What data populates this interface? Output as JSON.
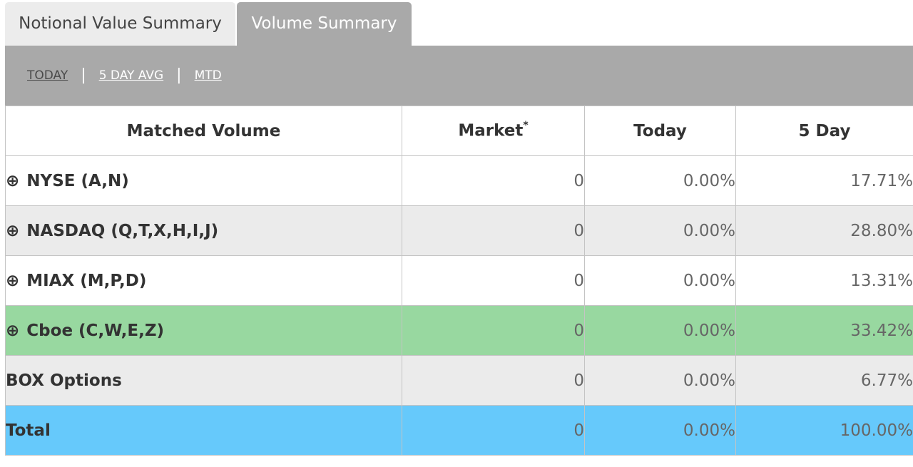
{
  "tabs": [
    {
      "label": "Notional Value Summary",
      "active": false
    },
    {
      "label": "Volume Summary",
      "active": true
    }
  ],
  "subnav": {
    "links": [
      {
        "label": "TODAY",
        "selected": true
      },
      {
        "label": "5 DAY AVG",
        "selected": false
      },
      {
        "label": "MTD",
        "selected": false
      }
    ],
    "separator": "|"
  },
  "table": {
    "headers": {
      "matched_volume": "Matched Volume",
      "market": "Market",
      "market_footnote": "*",
      "today": "Today",
      "five_day": "5 Day"
    },
    "expand_glyph": "⊕",
    "rows": [
      {
        "name": "NYSE (A,N)",
        "market": "0",
        "today": "0.00%",
        "five_day": "17.71%",
        "expandable": true
      },
      {
        "name": "NASDAQ (Q,T,X,H,I,J)",
        "market": "0",
        "today": "0.00%",
        "five_day": "28.80%",
        "expandable": true
      },
      {
        "name": "MIAX (M,P,D)",
        "market": "0",
        "today": "0.00%",
        "five_day": "13.31%",
        "expandable": true
      },
      {
        "name": "Cboe (C,W,E,Z)",
        "market": "0",
        "today": "0.00%",
        "five_day": "33.42%",
        "expandable": true
      },
      {
        "name": "BOX Options",
        "market": "0",
        "today": "0.00%",
        "five_day": "6.77%",
        "expandable": false
      },
      {
        "name": "Total",
        "market": "0",
        "today": "0.00%",
        "five_day": "100.00%",
        "expandable": false
      }
    ]
  },
  "colors": {
    "tab_active_bg": "#a9a9a9",
    "tab_inactive_bg": "#ececec",
    "row_alt_bg": "#ebebeb",
    "highlight_row_bg": "#98d8a0",
    "total_row_bg": "#66c9fb"
  }
}
